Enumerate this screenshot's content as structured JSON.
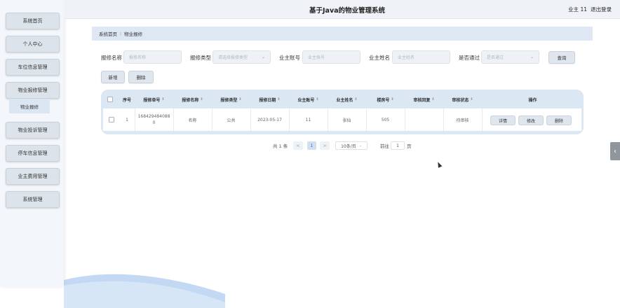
{
  "header": {
    "title": "基于Java的物业管理系统",
    "user": "业主 11",
    "logout": "退出登录"
  },
  "sidebar": {
    "items": [
      {
        "label": "系统首页"
      },
      {
        "label": "个人中心"
      },
      {
        "label": "车位信息管理"
      },
      {
        "label": "物业报修管理"
      },
      {
        "label": "物业投诉管理"
      },
      {
        "label": "停车信息管理"
      },
      {
        "label": "业主费用管理"
      },
      {
        "label": "系统管理"
      }
    ],
    "sub_item": "物业报修"
  },
  "breadcrumb": {
    "home": "系统首页",
    "separator": "⁝",
    "current": "物业报修"
  },
  "search": {
    "repair_name_label": "报修名称",
    "repair_name_placeholder": "报修名称",
    "repair_type_label": "报修类型",
    "repair_type_placeholder": "请选择报修类型",
    "owner_account_label": "业主账号",
    "owner_account_placeholder": "业主账号",
    "owner_name_label": "业主姓名",
    "owner_name_placeholder": "业主姓名",
    "approved_label": "是否通过",
    "approved_placeholder": "是否通过",
    "query_button": "查询"
  },
  "toolbar": {
    "add_button": "新增",
    "delete_button": "删除"
  },
  "table": {
    "columns": [
      "序号",
      "报修单号",
      "报修名称",
      "报修类型",
      "报修日期",
      "业主账号",
      "业主姓名",
      "楼房号",
      "审核回复",
      "审核状态",
      "操作"
    ],
    "rows": [
      {
        "index": "1",
        "order_no": "168429484088 0",
        "name": "名称",
        "type": "公共",
        "date": "2023-05-17",
        "account": "11",
        "owner": "张仙",
        "room": "505",
        "reply": "",
        "status": "待审核",
        "actions": {
          "detail": "详情",
          "edit": "修改",
          "delete": "删除"
        }
      }
    ]
  },
  "pagination": {
    "total": "共 1 条",
    "prev": "<",
    "page": "1",
    "next": ">",
    "page_size": "10条/页",
    "goto_label": "前往",
    "goto_value": "1",
    "goto_unit": "页"
  },
  "icons": {
    "dropdown": "chevron-down-icon",
    "handle": "chevron-left-icon",
    "checkbox": "checkbox-icon",
    "sort": "sort-icon"
  },
  "colors": {
    "accent": "#dde8f4",
    "sidebar": "#f3f6fa",
    "button": "#dfe6ee",
    "page_active": "#cfe0f3"
  }
}
